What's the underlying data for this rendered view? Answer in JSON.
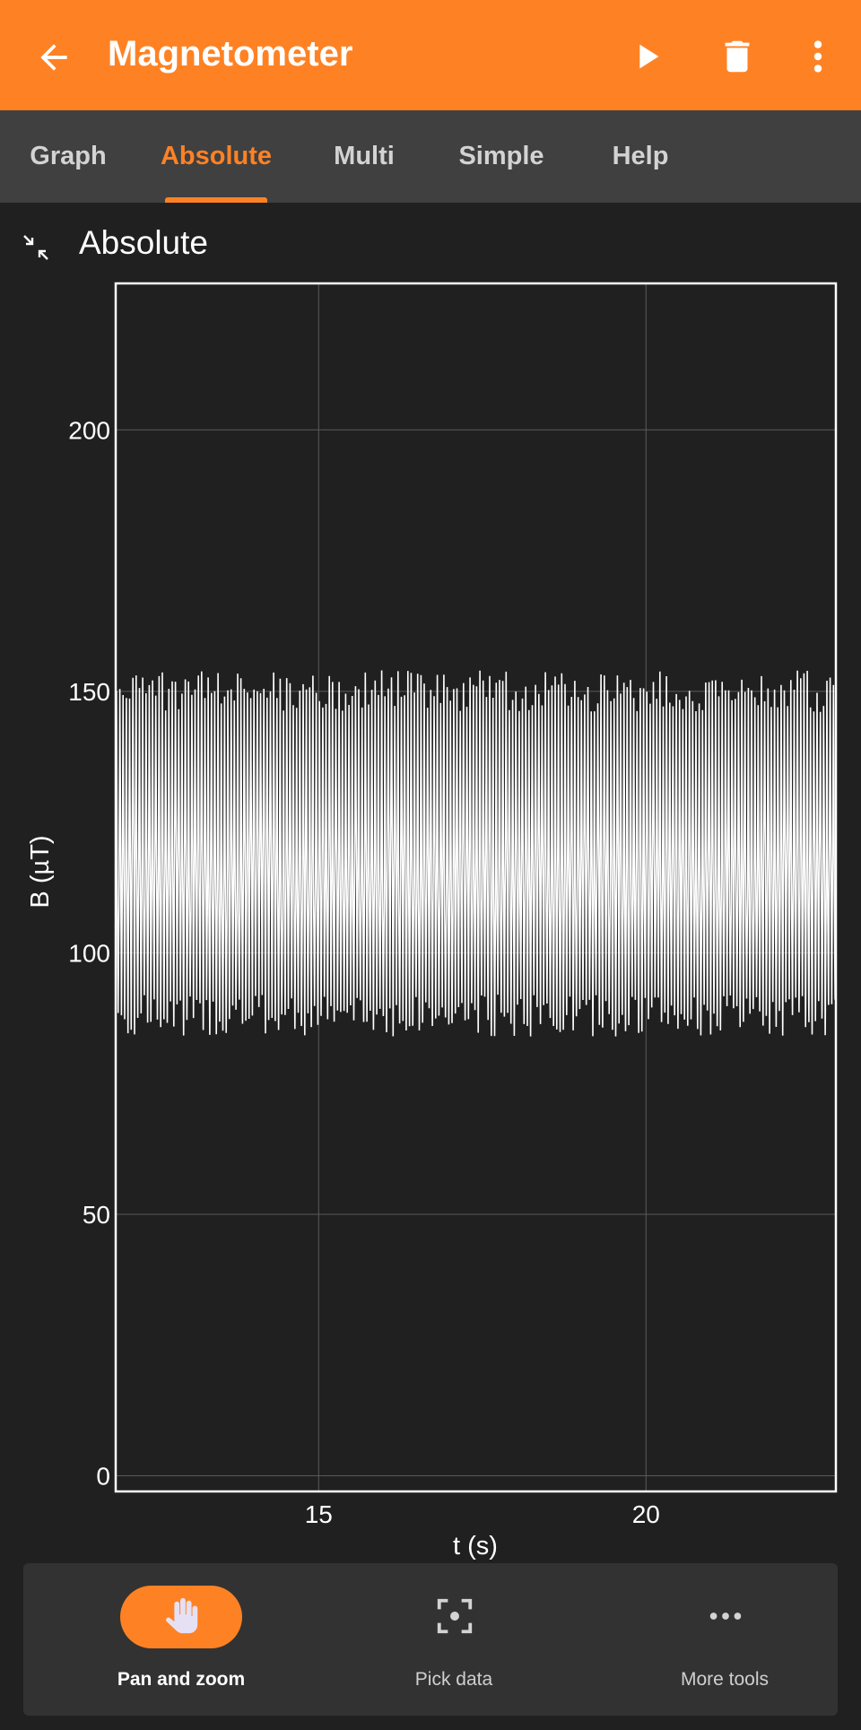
{
  "app": {
    "title": "Magnetometer",
    "accent_color": "#fe8224",
    "background_color": "#202020"
  },
  "appbar_icons": [
    "back-arrow-icon",
    "play-icon",
    "trash-icon",
    "more-vert-icon"
  ],
  "tabs": [
    {
      "label": "Graph",
      "active": false
    },
    {
      "label": "Absolute",
      "active": true
    },
    {
      "label": "Multi",
      "active": false
    },
    {
      "label": "Simple",
      "active": false
    },
    {
      "label": "Help",
      "active": false
    }
  ],
  "section": {
    "title": "Absolute",
    "icon": "collapse-icon"
  },
  "chart_data": {
    "type": "line",
    "title": "",
    "xlabel": "t (s)",
    "ylabel": "B (µT)",
    "xlim": [
      11.9,
      22.9
    ],
    "ylim": [
      -3,
      228
    ],
    "x_ticks": [
      15,
      20
    ],
    "y_ticks": [
      0,
      50,
      100,
      150,
      200
    ],
    "grid": true,
    "series": [
      {
        "color": "#ffffff",
        "description_range": [
          84,
          154
        ],
        "dense_band": [
          107,
          123
        ],
        "approx_period_s": 0.05
      }
    ]
  },
  "toolbar": {
    "items": [
      {
        "label": "Pan and zoom",
        "icon": "hand-icon",
        "active": true
      },
      {
        "label": "Pick data",
        "icon": "crosshair-icon",
        "active": false
      },
      {
        "label": "More tools",
        "icon": "more-horiz-icon",
        "active": false
      }
    ]
  }
}
